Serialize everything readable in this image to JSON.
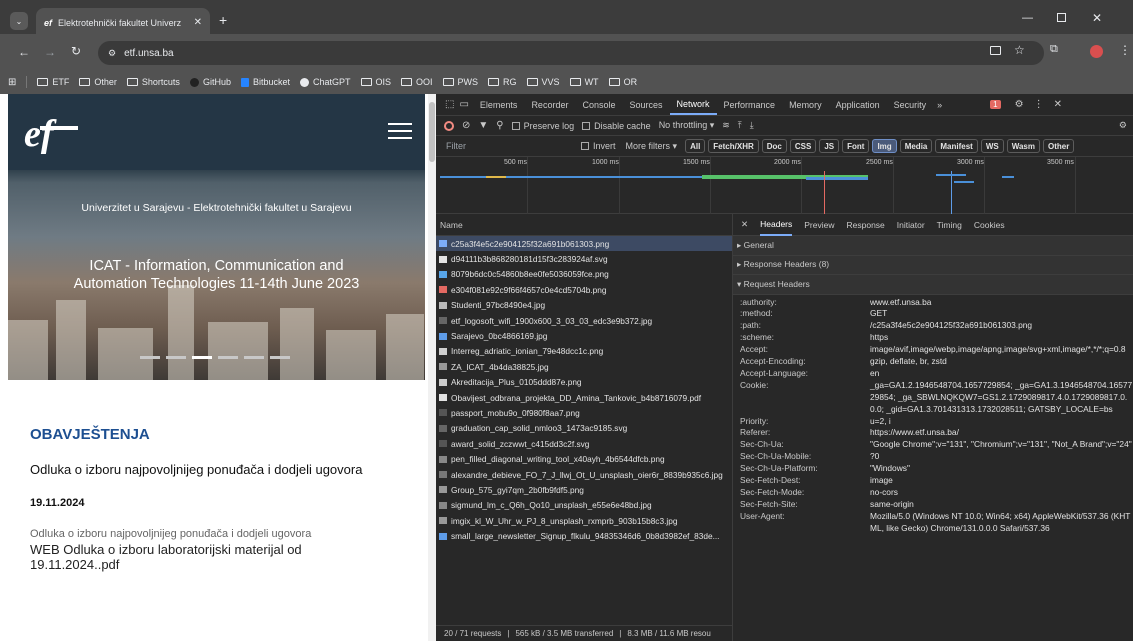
{
  "browser": {
    "tab_title": "Elektrotehnički fakultet Univerz",
    "url": "etf.unsa.ba",
    "bookmarks": [
      "ETF",
      "Other",
      "Shortcuts",
      "GitHub",
      "Bitbucket",
      "ChatGPT",
      "OIS",
      "OOI",
      "PWS",
      "RG",
      "VVS",
      "WT",
      "OR"
    ]
  },
  "site": {
    "hero_subtitle": "Univerzitet u Sarajevu - Elektrotehnički fakultet u Sarajevu",
    "hero_title_line1": "ICAT - Information, Communication and",
    "hero_title_line2": "Automation Technologies 11-14th June 2023",
    "section_heading": "OBAVJEŠTENJA",
    "news_title": "Odluka o izboru najpovoljnijeg ponuđača i dodjeli ugovora",
    "news_date": "19.11.2024",
    "news_excerpt": "Odluka o izboru najpovoljnijeg ponuđača i dodjeli ugovora",
    "news_attachment_line1": "WEB Odluka o izboru laboratorijski materijal od",
    "news_attachment_line2": "19.11.2024..pdf"
  },
  "devtools": {
    "tabs": [
      "Elements",
      "Recorder",
      "Console",
      "Sources",
      "Network",
      "Performance",
      "Memory",
      "Application",
      "Security"
    ],
    "active_tab": "Network",
    "error_count": "1",
    "preserve_log": "Preserve log",
    "disable_cache": "Disable cache",
    "throttling": "No throttling",
    "filter_placeholder": "Filter",
    "invert": "Invert",
    "more_filters": "More filters",
    "type_filters": [
      "All",
      "Fetch/XHR",
      "Doc",
      "CSS",
      "JS",
      "Font",
      "Img",
      "Media",
      "Manifest",
      "WS",
      "Wasm",
      "Other"
    ],
    "active_filter": "Img",
    "timeline_ticks": [
      "500 ms",
      "1000 ms",
      "1500 ms",
      "2000 ms",
      "2500 ms",
      "3000 ms",
      "3500 ms"
    ],
    "name_header": "Name",
    "requests": [
      "c25a3f4e5c2e904125f32a691b061303.png",
      "d94111b3b868280181d15f3c283924af.svg",
      "8079b6dc0c54860b8ee0fe5036059fce.png",
      "e304f081e92c9f66f4657c0e4cd5704b.png",
      "Studenti_97bc8490e4.jpg",
      "etf_logosoft_wifi_1900x600_3_03_03_edc3e9b372.jpg",
      "Sarajevo_0bc4866169.jpg",
      "Interreg_adriatic_ionian_79e48dcc1c.png",
      "ZA_ICAT_4b4da38825.jpg",
      "Akreditacija_Plus_0105ddd87e.png",
      "Obavijest_odbrana_projekta_DD_Amina_Tankovic_b4b8716079.pdf",
      "passport_mobu9o_0f980f8aa7.png",
      "graduation_cap_solid_nmloo3_1473ac9185.svg",
      "award_solid_zczwwt_c415dd3c2f.svg",
      "pen_filled_diagonal_writing_tool_x40ayh_4b6544dfcb.png",
      "alexandre_debieve_FO_7_J_llwj_Ot_U_unsplash_oier6r_8839b935c6.jpg",
      "Group_575_gyi7qm_2b0fb9fdf5.png",
      "sigmund_lm_c_Q6h_Qo10_unsplash_e55e6e48bd.jpg",
      "imgix_kl_W_Uhr_w_PJ_8_unsplash_rxmprb_903b15b8c3.jpg",
      "small_large_newsletter_Signup_flkulu_94835346d6_0b8d3982ef_83de..."
    ],
    "status_requests": "20 / 71 requests",
    "status_transferred": "565 kB / 3.5 MB transferred",
    "status_resources": "8.3 MB / 11.6 MB resou",
    "detail_tabs": [
      "Headers",
      "Preview",
      "Response",
      "Initiator",
      "Timing",
      "Cookies"
    ],
    "active_detail_tab": "Headers",
    "section_general": "▸ General",
    "section_response": "▸ Response Headers (8)",
    "section_request": "▾ Request Headers",
    "headers": [
      {
        "k": ":authority:",
        "v": "www.etf.unsa.ba"
      },
      {
        "k": ":method:",
        "v": "GET"
      },
      {
        "k": ":path:",
        "v": "/c25a3f4e5c2e904125f32a691b061303.png"
      },
      {
        "k": ":scheme:",
        "v": "https"
      },
      {
        "k": "Accept:",
        "v": "image/avif,image/webp,image/apng,image/svg+xml,image/*,*/*;q=0.8"
      },
      {
        "k": "Accept-Encoding:",
        "v": "gzip, deflate, br, zstd"
      },
      {
        "k": "Accept-Language:",
        "v": "en"
      },
      {
        "k": "Cookie:",
        "v": "_ga=GA1.2.1946548704.1657729854; _ga=GA1.3.1946548704.1657729854; _ga_SBWLNQKQW7=GS1.2.1729089817.4.0.1729089817.0.0.0; _gid=GA1.3.701431313.1732028511; GATSBY_LOCALE=bs"
      },
      {
        "k": "Priority:",
        "v": "u=2, i"
      },
      {
        "k": "Referer:",
        "v": "https://www.etf.unsa.ba/"
      },
      {
        "k": "Sec-Ch-Ua:",
        "v": "\"Google Chrome\";v=\"131\", \"Chromium\";v=\"131\", \"Not_A Brand\";v=\"24\""
      },
      {
        "k": "Sec-Ch-Ua-Mobile:",
        "v": "?0"
      },
      {
        "k": "Sec-Ch-Ua-Platform:",
        "v": "\"Windows\""
      },
      {
        "k": "Sec-Fetch-Dest:",
        "v": "image"
      },
      {
        "k": "Sec-Fetch-Mode:",
        "v": "no-cors"
      },
      {
        "k": "Sec-Fetch-Site:",
        "v": "same-origin"
      },
      {
        "k": "User-Agent:",
        "v": "Mozilla/5.0 (Windows NT 10.0; Win64; x64) AppleWebKit/537.36 (KHTML, like Gecko) Chrome/131.0.0.0 Safari/537.36"
      }
    ]
  },
  "colors": {
    "accent_blue": "#1a73e8",
    "site_heading_blue": "#1d4f91",
    "devtools_bg": "#282828",
    "chrome_frame": "#3c3c3c"
  }
}
